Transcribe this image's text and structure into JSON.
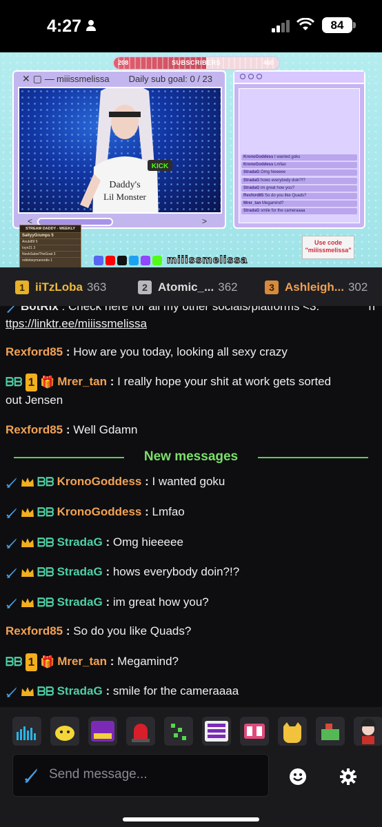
{
  "status_bar": {
    "time": "4:27",
    "battery": "84"
  },
  "stream": {
    "subscribers_label": "SUBSCRIBERS",
    "subscribers_low": "208",
    "subscribers_high": "460",
    "subscribers_progress": 0.56,
    "cam_window_title": "miiissmelissa",
    "sub_goal": "Daily sub goal: 0 / 23",
    "window_controls": "✕ ▢ —",
    "slider_left": "<",
    "slider_right": ">",
    "social_handle": "miiissmelissa",
    "promo_text": "Use code \"miiissmelissa\"",
    "leaderboard_title": "STREAM DADDY - WEEKLY",
    "leaderboard_top": "SaltyyGrumps 5",
    "leaderboard_rows": [
      "Anubi89 5",
      "Ioyn21 3",
      "NoobSabelTheGoat 3",
      "roblebeymanordis 1"
    ],
    "mini_chat": [
      {
        "user": "KronoGoddess",
        "text": "I wanted goku"
      },
      {
        "user": "KronoGoddess",
        "text": "Lmfao"
      },
      {
        "user": "StradaG",
        "text": "Omg hieeeee"
      },
      {
        "user": "StradaG",
        "text": "hows everybody doin?!?"
      },
      {
        "user": "StradaG",
        "text": "im great how you?"
      },
      {
        "user": "Rexford85",
        "text": "So do you like Quads?"
      },
      {
        "user": "Mrer_tan",
        "text": "Megamind?"
      },
      {
        "user": "StradaG",
        "text": "smile for the cameraaaa"
      }
    ]
  },
  "gifters": [
    {
      "rank": "1",
      "name": "iiTzLoba",
      "count": "363"
    },
    {
      "rank": "2",
      "name": "Atomic_...",
      "count": "362"
    },
    {
      "rank": "3",
      "name": "Ashleigh...",
      "count": "302"
    }
  ],
  "chat": {
    "partial": {
      "user": "BotRix",
      "text": "Check here for all my other socials/platforms <3:",
      "link": "ttps://linktr.ee/miiissmelissa",
      "link_prefix": "h"
    },
    "messages_before": [
      {
        "user": "Rexford85",
        "text": "How are you today, looking all sexy crazy"
      },
      {
        "user": "Mrer_tan",
        "text": "I really hope your shit at work gets sorted",
        "text2": "out Jensen"
      },
      {
        "user": "Rexford85",
        "text": "Well Gdamn"
      }
    ],
    "separator": "New messages",
    "messages_after": [
      {
        "user": "KronoGoddess",
        "text": "I wanted goku"
      },
      {
        "user": "KronoGoddess",
        "text": "Lmfao"
      },
      {
        "user": "StradaG",
        "text": "Omg hieeeee"
      },
      {
        "user": "StradaG",
        "text": "hows everybody doin?!?"
      },
      {
        "user": "StradaG",
        "text": "im great how you?"
      },
      {
        "user": "Rexford85",
        "text": "So do you like Quads?"
      },
      {
        "user": "Mrer_tan",
        "text": "Megamind?"
      },
      {
        "user": "StradaG",
        "text": "smile for the cameraaaa"
      }
    ],
    "colon": ":"
  },
  "input": {
    "placeholder": "Send message..."
  },
  "emotes": [
    "equalizer-emote",
    "blob-emote",
    "sub-hype-emote",
    "siren-emote",
    "dots-emote",
    "hype-hype-hype-emote",
    "ee-emote",
    "cat-emote",
    "box-emote",
    "character-emote"
  ],
  "colors": {
    "accent_green": "#7be06b",
    "orange_user": "#f2a355",
    "green_user": "#4fd0a5"
  }
}
